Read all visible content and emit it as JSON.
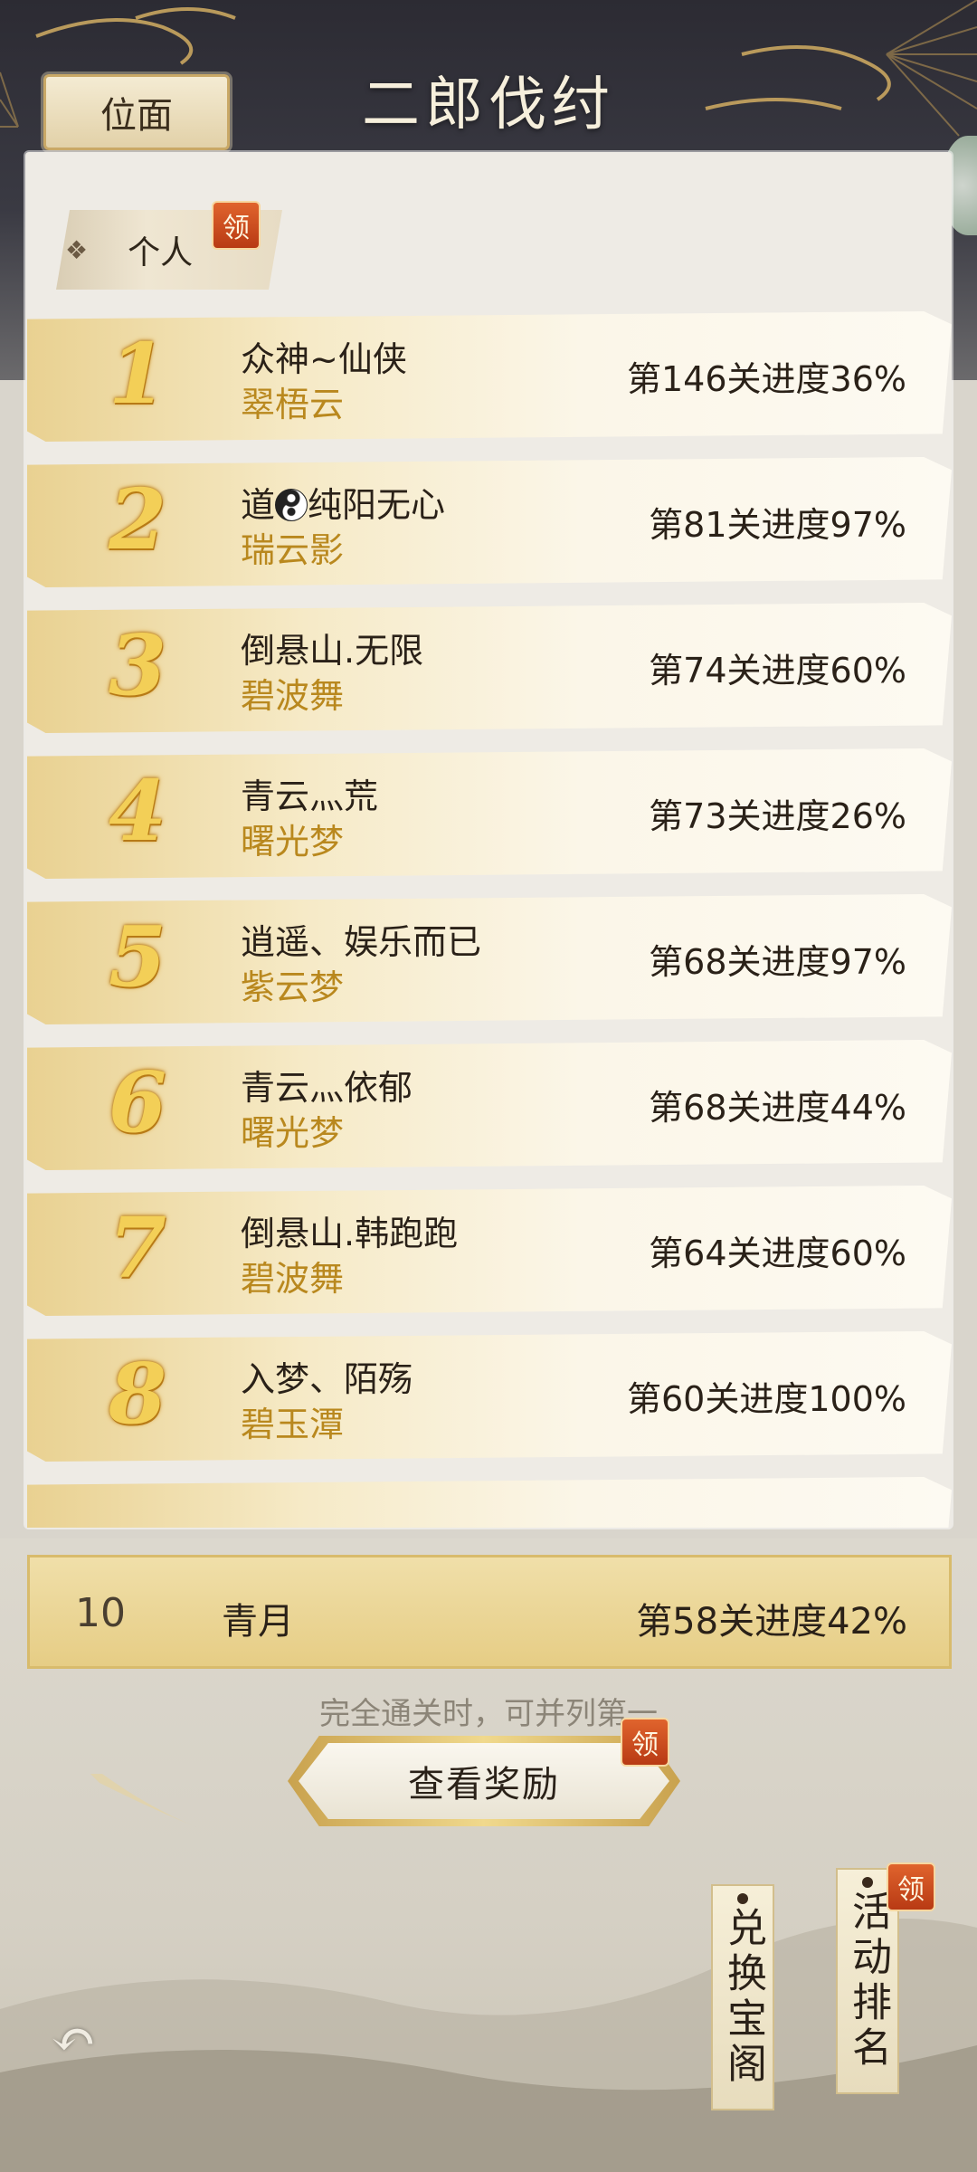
{
  "header": {
    "title": "二郎伐纣",
    "realm_button": "位面"
  },
  "tabs": [
    {
      "label": "个人",
      "badge": "领"
    }
  ],
  "ranking": [
    {
      "rank": "1",
      "name": "众神~仙侠",
      "server": "翠梧云",
      "progress": "第146关进度36%"
    },
    {
      "rank": "2",
      "name_before_icon": "道",
      "name_after_icon": "纯阳无心",
      "server": "瑞云影",
      "progress": "第81关进度97%",
      "icon": "yin-yang-icon"
    },
    {
      "rank": "3",
      "name": "倒悬山.无限",
      "server": "碧波舞",
      "progress": "第74关进度60%"
    },
    {
      "rank": "4",
      "name": "青云灬荒",
      "server": "曙光梦",
      "progress": "第73关进度26%"
    },
    {
      "rank": "5",
      "name": "逍遥、娱乐而已",
      "server": "紫云梦",
      "progress": "第68关进度97%"
    },
    {
      "rank": "6",
      "name": "青云灬依郁",
      "server": "曙光梦",
      "progress": "第68关进度44%"
    },
    {
      "rank": "7",
      "name": "倒悬山.韩跑跑",
      "server": "碧波舞",
      "progress": "第64关进度60%"
    },
    {
      "rank": "8",
      "name": "入梦、陌殇",
      "server": "碧玉潭",
      "progress": "第60关进度100%"
    }
  ],
  "my_rank": {
    "rank": "10",
    "name": "青月",
    "progress": "第58关进度42%"
  },
  "hint": "完全通关时，可并列第一",
  "reward_button": {
    "label": "查看奖励",
    "badge": "领"
  },
  "side_tags": [
    {
      "label": "兑换宝阁"
    },
    {
      "label": "活动排名",
      "badge": "领"
    }
  ],
  "colors": {
    "gold_text": "#b9881e",
    "rank_gold": "#f3cf57",
    "badge_red": "#c94a1c"
  }
}
